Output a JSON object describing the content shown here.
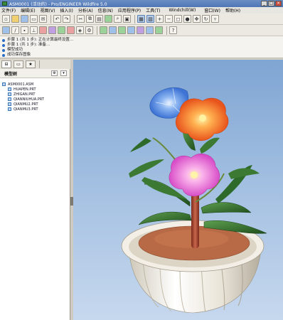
{
  "window": {
    "title": "ASM0001 (活动的) - Pro/ENGINEER Wildfire 5.0",
    "controls": [
      "_",
      "□",
      "×"
    ]
  },
  "menu": [
    "文件(F)",
    "编辑(E)",
    "视图(V)",
    "插入(I)",
    "分析(A)",
    "信息(N)",
    "应用程序(P)",
    "工具(T)",
    "Windchill(W)",
    "窗口(W)",
    "帮助(H)"
  ],
  "toolbar": {
    "row1": [
      "new-file-icon",
      "open-icon",
      "save-icon",
      "print-icon",
      "email-icon",
      "undo-icon",
      "redo-icon",
      "cut-icon",
      "copy-icon",
      "paste-icon",
      "regenerate-icon",
      "search-icon",
      "select-icon",
      "repaint-icon",
      "orient-icon",
      "zoom-in-icon",
      "zoom-out-icon",
      "refit-icon",
      "shading-icon",
      "pan-icon",
      "spin-icon",
      "saved-views-icon"
    ],
    "row2": [
      "datum-plane-icon",
      "datum-axis-icon",
      "datum-point-icon",
      "coordinate-system-icon",
      "hide-icon",
      "layer-icon",
      "model-display-icon",
      "color-icon",
      "render-icon",
      "setup-icon",
      "appearance-icon",
      "mapkey-icon",
      "measure-icon",
      "analysis-icon",
      "help-icon"
    ]
  },
  "messages": [
    "步骤 1 (共 1 步): 正在计算最终设置...",
    "步骤 1 (共 1 步): 准备...",
    "模型成功",
    "成功保存图像"
  ],
  "navigator": {
    "tabs": [
      "model-tree-tab",
      "folder-browser-tab",
      "favorites-tab"
    ],
    "title": "模型树",
    "tree": {
      "root": "ASM0001.ASM",
      "children": [
        "HUAPEN.PRT",
        "ZHIGAN.PRT",
        "QIANNIUHUA.PRT",
        "QIANMU2.PRT",
        "QIANMU3.PRT"
      ]
    }
  },
  "colors": {
    "title_bg": "#4f76b6",
    "viewport_top": "#7fa5d3",
    "viewport_bottom": "#c6d8ee",
    "pot": "#f2eee4",
    "soil": "#b76a45",
    "stem": "#b0513a",
    "flower_orange": "#f47c3a",
    "flower_pink": "#f07ad8",
    "flower_blue": "#5f93e6",
    "leaf": "#2e6b2a"
  }
}
